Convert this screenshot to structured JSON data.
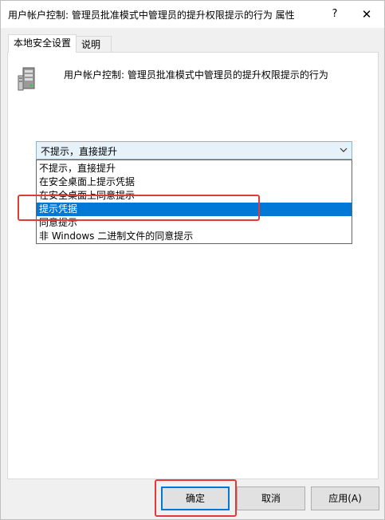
{
  "window": {
    "title": "用户帐户控制: 管理员批准模式中管理员的提升权限提示的行为 属性",
    "help_glyph": "?",
    "close_glyph": "✕"
  },
  "tabs": [
    {
      "label": "本地安全设置",
      "active": true
    },
    {
      "label": "说明",
      "active": false
    }
  ],
  "policy": {
    "icon": "server-icon",
    "name": "用户帐户控制: 管理员批准模式中管理员的提升权限提示的行为"
  },
  "combo": {
    "value": "不提示，直接提升",
    "arrow_icon": "chevron-down-icon"
  },
  "dropdown": {
    "options": [
      "不提示，直接提升",
      "在安全桌面上提示凭据",
      "在安全桌面上同意提示",
      "提示凭据",
      "同意提示",
      "非 Windows 二进制文件的同意提示"
    ],
    "selected_index": 3
  },
  "buttons": {
    "ok": "确定",
    "cancel": "取消",
    "apply": "应用(A)"
  },
  "colors": {
    "selection": "#0078d7",
    "annotation": "#e53935",
    "combo_focus_bg": "#e5f1fb"
  }
}
